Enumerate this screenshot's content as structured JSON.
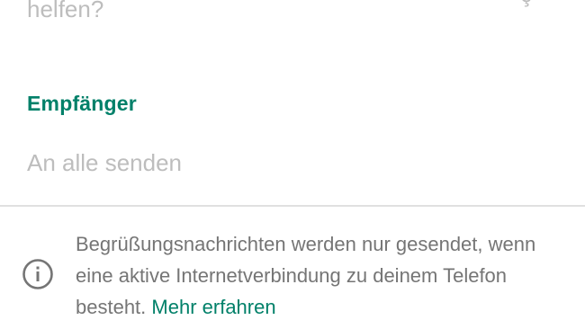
{
  "message_preview": {
    "visible_fragment": "helfen?"
  },
  "recipients": {
    "section_label": "Empfänger",
    "value": "An alle senden"
  },
  "info": {
    "icon": "info-icon",
    "text": "Begrüßungsnachrichten werden nur gesendet, wenn eine aktive Internetverbindung zu deinem Telefon besteht.",
    "link_label": "Mehr erfahren"
  },
  "colors": {
    "accent": "#008069",
    "muted_text": "#757575",
    "placeholder_text": "#bdbdbd",
    "divider": "#e0e0e0"
  }
}
